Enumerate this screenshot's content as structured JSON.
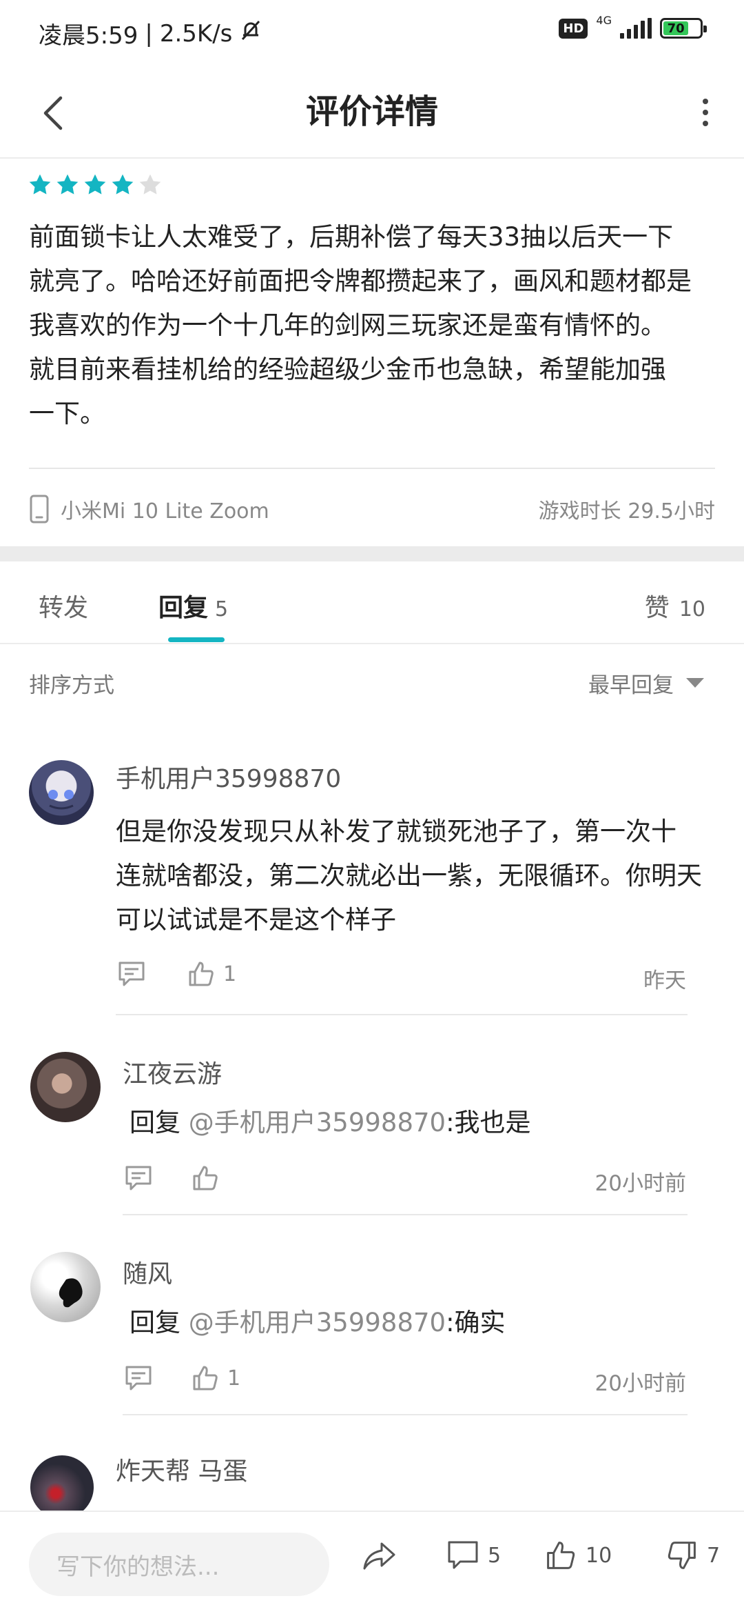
{
  "status_bar": {
    "time": "凌晨5:59",
    "net_speed": "2.5K/s",
    "hd": "HD",
    "network": "4G",
    "battery": "70"
  },
  "header": {
    "title": "评价详情"
  },
  "review": {
    "rating": 4,
    "rating_max": 5,
    "text_lines": [
      "前面锁卡让人太难受了，后期补偿了每天33抽以后天一下",
      "就亮了。哈哈还好前面把令牌都攒起来了，画风和题材都是",
      "我喜欢的作为一个十几年的剑网三玩家还是蛮有情怀的。",
      "就目前来看挂机给的经验超级少金币也急缺，希望能加强",
      "一下。"
    ],
    "device": "小米Mi 10 Lite Zoom",
    "play_time": "游戏时长 29.5小时"
  },
  "tabs": {
    "forward": "转发",
    "reply": "回复",
    "reply_count": "5",
    "like": "赞",
    "like_count": "10"
  },
  "sort": {
    "label": "排序方式",
    "value": "最早回复"
  },
  "comments": [
    {
      "name": "手机用户35998870",
      "lines": [
        "但是你没发现只从补发了就锁死池子了，第一次十",
        "连就啥都没，第二次就必出一紫，无限循环。你明天",
        "可以试试是不是这个样子"
      ],
      "likes": "1",
      "time": "昨天"
    },
    {
      "name": "江夜云游",
      "reply_prefix": "回复 ",
      "mention": "@手机用户35998870",
      "reply_text": ":我也是",
      "likes": "",
      "time": "20小时前"
    },
    {
      "name": "随风",
      "reply_prefix": "回复 ",
      "mention": "@手机用户35998870",
      "reply_text": ":确实",
      "likes": "1",
      "time": "20小时前"
    },
    {
      "name": "炸天帮 马蛋"
    }
  ],
  "bottom_bar": {
    "placeholder": "写下你的想法...",
    "comment_count": "5",
    "like_count": "10",
    "dislike_count": "7"
  },
  "colors": {
    "accent": "#14b5c2",
    "star_empty": "#dddddd"
  }
}
